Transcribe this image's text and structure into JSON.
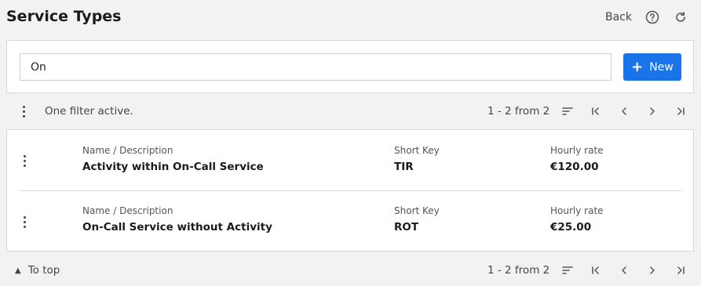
{
  "header": {
    "title": "Service Types",
    "back_label": "Back",
    "help_icon": "help-circle-icon",
    "refresh_icon": "refresh-icon"
  },
  "search": {
    "value": "On",
    "new_label": "New",
    "new_icon": "plus-icon",
    "accent_color": "#1a73e8"
  },
  "top_toolbar": {
    "filter_status": "One filter active.",
    "range": "1 - 2 from 2"
  },
  "bottom_toolbar": {
    "to_top_label": "To top",
    "range": "1 - 2 from 2"
  },
  "table": {
    "columns": [
      "Name / Description",
      "Short Key",
      "Hourly rate"
    ],
    "rows": [
      {
        "name": "Activity within On-Call Service",
        "short_key": "TIR",
        "rate": "€120.00"
      },
      {
        "name": "On-Call Service without Activity",
        "short_key": "ROT",
        "rate": "€25.00"
      }
    ]
  }
}
